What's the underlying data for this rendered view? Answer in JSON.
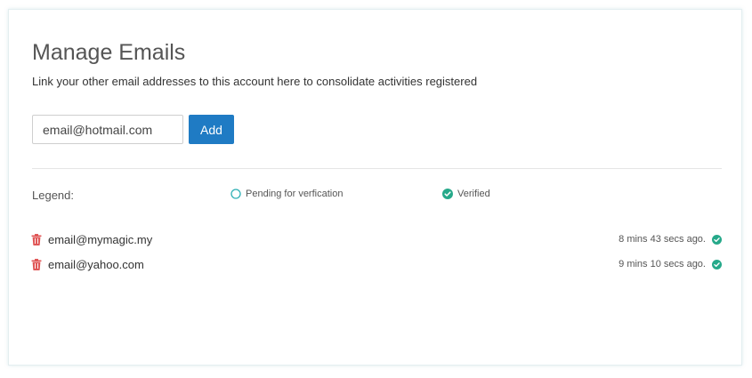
{
  "header": {
    "title": "Manage Emails",
    "subtitle": "Link your other email addresses to this account here to consolidate activities registered"
  },
  "form": {
    "input_value": "email@hotmail.com",
    "add_label": "Add"
  },
  "legend": {
    "label": "Legend:",
    "pending_label": "Pending for verfication",
    "verified_label": "Verified"
  },
  "emails": [
    {
      "address": "email@mymagic.my",
      "time": "8 mins 43 secs ago.",
      "status": "verified"
    },
    {
      "address": "email@yahoo.com",
      "time": "9 mins 10 secs ago.",
      "status": "verified"
    }
  ],
  "colors": {
    "accent": "#1f7bc4",
    "verified": "#26a98a",
    "pending": "#2fb0b5",
    "trash": "#e05757"
  },
  "icons": {
    "delete": "trash-icon",
    "pending": "circle-outline-icon",
    "verified": "check-circle-icon"
  }
}
